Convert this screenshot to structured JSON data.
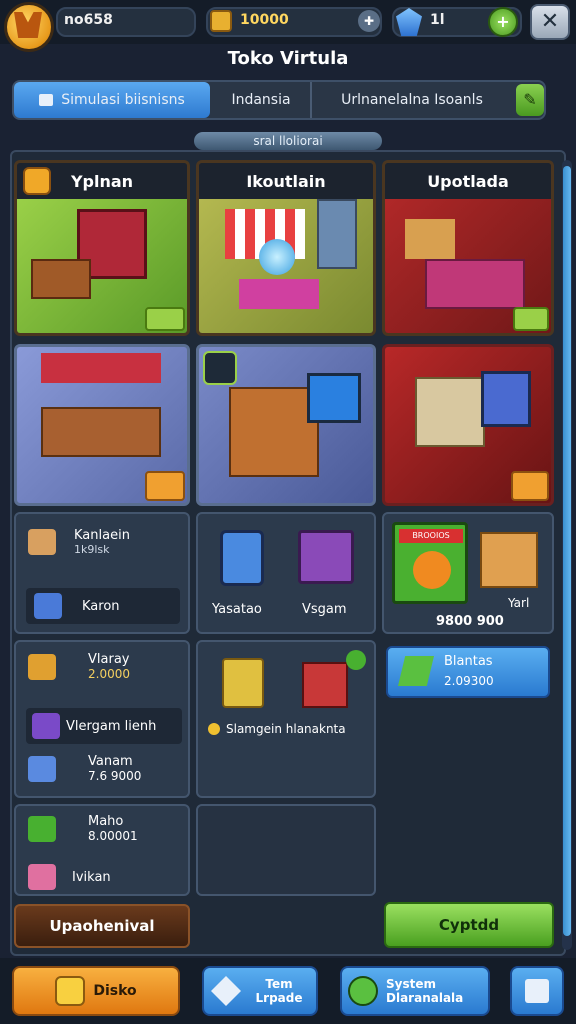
{
  "top": {
    "player": "no658",
    "coins": "10000",
    "gems": "1l"
  },
  "title": "Toko Virtula",
  "tabs": [
    "Simulasi biisnisns",
    "Indansia",
    "Urlnanelalna Isoanls"
  ],
  "section_label": "sral lloliorai",
  "shops": [
    {
      "title": "Yplnan"
    },
    {
      "title": "Ikoutlain"
    },
    {
      "title": "Upotlada"
    }
  ],
  "items": {
    "a1_title": "Kanlaein",
    "a1_sub": "1k9lsk",
    "a2": "Karon",
    "b1": "Yasatao",
    "b2": "Vsgam",
    "c_tag": "BROOIOS",
    "c_label": "Yarl",
    "c_value": "9800 900",
    "d1_title": "Vlaray",
    "d1_value": "2.0000",
    "d2": "Vlergam lienh",
    "d3_title": "Vanam",
    "d3_value": "7.6 9000",
    "d4_title": "Maho",
    "d4_value": "8.00001",
    "d5": "Ivikan",
    "e1": "Slamgein hlanaknta",
    "f1_title": "Blantas",
    "f1_value": "2.09300"
  },
  "buttons": {
    "upgrade_left": "Upaohenival",
    "upgrade_right": "Cyptdd"
  },
  "bottom": [
    {
      "label": "Disko"
    },
    {
      "label": "Tem Lrpade"
    },
    {
      "label": "System Dlaranalala"
    }
  ]
}
